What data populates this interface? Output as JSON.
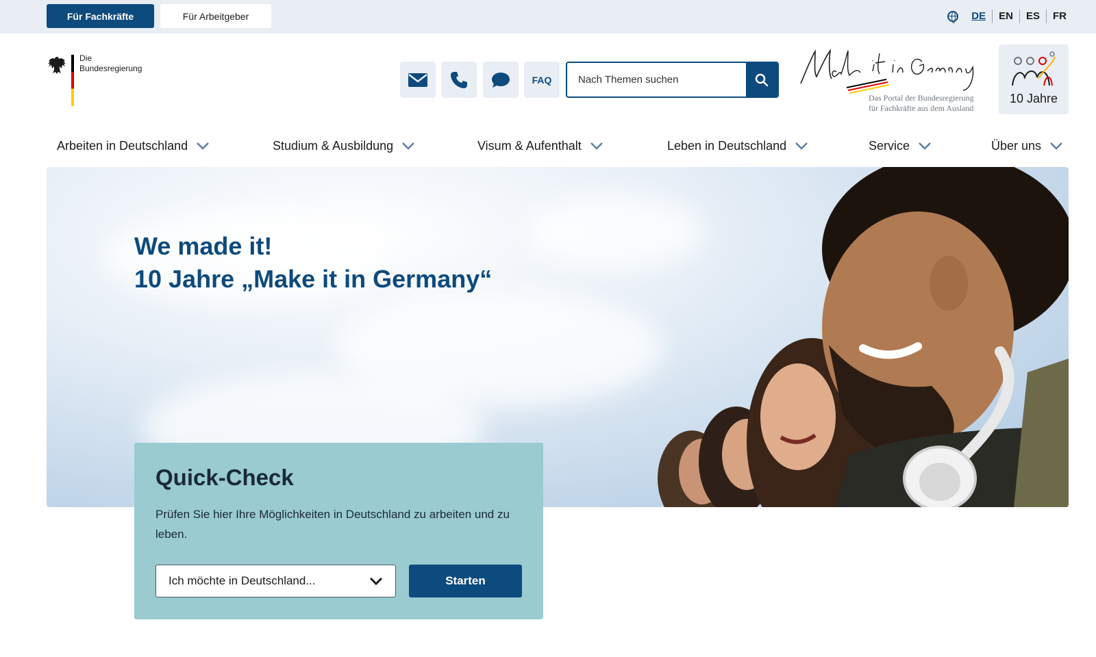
{
  "topbar": {
    "audience_active": "Für Fachkräfte",
    "audience_other": "Für Arbeitgeber",
    "languages": [
      "DE",
      "EN",
      "ES",
      "FR"
    ],
    "active_language": "DE"
  },
  "header": {
    "logo_line1": "Die",
    "logo_line2": "Bundesregierung",
    "faq_label": "FAQ",
    "search_placeholder": "Nach Themen suchen",
    "brand_script": "Make it in Germany",
    "brand_tagline_line1": "Das Portal der Bundesregierung",
    "brand_tagline_line2": "für Fachkräfte aus dem Ausland",
    "anniversary_badge": "10 Jahre"
  },
  "nav": {
    "items": [
      {
        "label": "Arbeiten in Deutschland"
      },
      {
        "label": "Studium & Ausbildung"
      },
      {
        "label": "Visum & Aufenthalt"
      },
      {
        "label": "Leben in Deutschland"
      },
      {
        "label": "Service"
      },
      {
        "label": "Über uns"
      }
    ]
  },
  "hero": {
    "title_line1": "We made it!",
    "title_line2": "10 Jahre „Make it in Germany“"
  },
  "quick_check": {
    "title": "Quick-Check",
    "description": "Prüfen Sie hier Ihre Möglichkeiten in Deutschland zu arbeiten und zu leben.",
    "select_value": "Ich möchte in Deutschland...",
    "start_label": "Starten"
  },
  "colors": {
    "primary": "#0d4a7d",
    "topbar_bg": "#e9eef5",
    "quick_check_bg": "#99cbd0"
  },
  "icons": [
    "globe-icon",
    "mail-icon",
    "phone-icon",
    "chat-icon",
    "search-icon",
    "chevron-down-icon"
  ]
}
